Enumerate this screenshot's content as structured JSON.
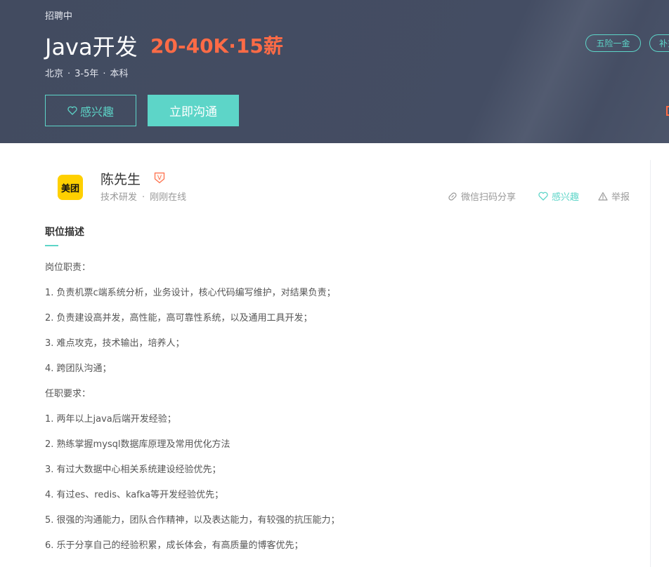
{
  "header": {
    "status": "招聘中",
    "title": "Java开发",
    "salary": "20-40K·15薪",
    "meta": {
      "city": "北京",
      "experience": "3-5年",
      "degree": "本科",
      "sep": "·"
    },
    "buttons": {
      "interest": "感兴趣",
      "chat": "立即沟通"
    },
    "tags": [
      "五险一金",
      "补充医疗保险"
    ]
  },
  "recruiter": {
    "logo_text": "美团",
    "name": "陈先生",
    "badge": "V",
    "department": "技术研发",
    "sep": "·",
    "status": "刚刚在线"
  },
  "actions": {
    "share": "微信扫码分享",
    "like": "感兴趣",
    "report": "举报"
  },
  "section": {
    "title": "职位描述",
    "lines": [
      "岗位职责：",
      "1. 负责机票c端系统分析，业务设计，核心代码编写维护，对结果负责；",
      "2. 负责建设高并发，高性能，高可靠性系统，以及通用工具开发；",
      "3. 难点攻克，技术输出，培养人；",
      "4. 跨团队沟通；",
      "任职要求：",
      "1. 两年以上java后端开发经验；",
      "2. 熟练掌握mysql数据库原理及常用优化方法",
      "3. 有过大数据中心相关系统建设经验优先；",
      "4. 有过es、redis、kafka等开发经验优先；",
      "5. 很强的沟通能力，团队合作精神，以及表达能力，有较强的抗压能力；",
      "6. 乐于分享自己的经验积累，成长体会，有高质量的博客优先；"
    ]
  },
  "colors": {
    "accent": "#5dd5c8",
    "salary": "#fe6b46",
    "hero_bg": "#444d63",
    "logo_bg": "#ffd000"
  }
}
